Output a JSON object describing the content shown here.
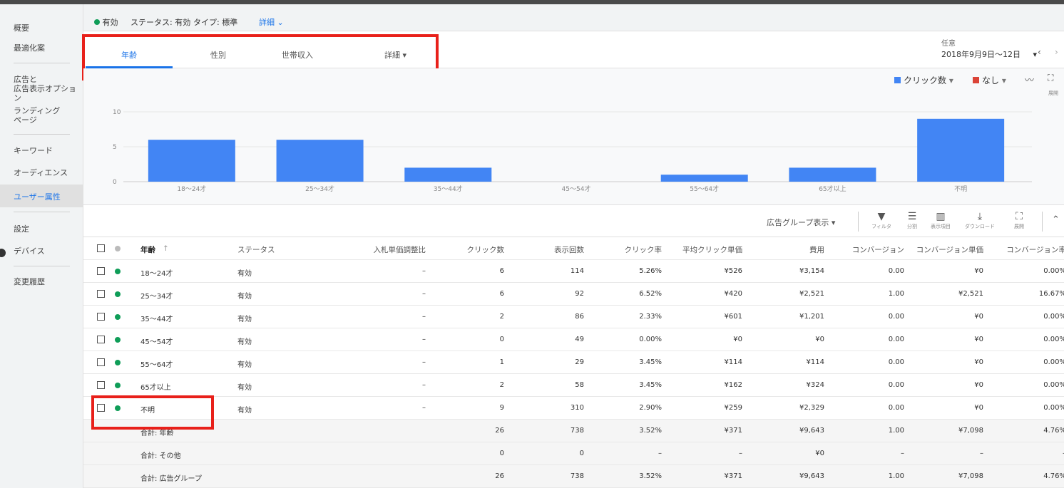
{
  "sidebar": {
    "items": [
      {
        "label": "概要"
      },
      {
        "label": "最適化案"
      },
      {
        "label": "広告と\n広告表示オプション"
      },
      {
        "label": "ランディング\nページ"
      },
      {
        "label": "キーワード"
      },
      {
        "label": "オーディエンス"
      },
      {
        "label": "ユーザー属性"
      },
      {
        "label": "設定"
      },
      {
        "label": "デバイス"
      },
      {
        "label": "変更履歴"
      }
    ]
  },
  "status": {
    "enabled": "有効",
    "status_text": "ステータス: 有効",
    "type_text": "タイプ: 標準",
    "detail": "詳細"
  },
  "tabs": [
    {
      "label": "年齢"
    },
    {
      "label": "性別"
    },
    {
      "label": "世帯収入"
    },
    {
      "label": "詳細"
    }
  ],
  "date": {
    "label": "任意",
    "range": "2018年9月9日～12日"
  },
  "chart_controls": {
    "metric1": "クリック数",
    "metric2": "なし",
    "expand": "展開",
    "metric1_color": "#4285f4",
    "metric2_color": "#db4437"
  },
  "chart_data": {
    "type": "bar",
    "categories": [
      "18～24才",
      "25～34才",
      "35～44才",
      "45～54才",
      "55～64才",
      "65才以上",
      "不明"
    ],
    "values": [
      6,
      6,
      2,
      0,
      1,
      2,
      9
    ],
    "yticks": [
      "0",
      "5",
      "10"
    ],
    "ylim": [
      0,
      10
    ],
    "color": "#4285f4"
  },
  "toolbar": {
    "view": "広告グループ表示",
    "filter": "フィルタ",
    "segment": "分割",
    "columns": "表示項目",
    "download": "ダウンロード",
    "expand": "展開"
  },
  "table": {
    "headers": [
      "年齢",
      "ステータス",
      "入札単価調整比",
      "クリック数",
      "表示回数",
      "クリック率",
      "平均クリック単価",
      "費用",
      "コンバージョン",
      "コンバージョン単価",
      "コンバージョン率"
    ],
    "rows": [
      [
        "18～24才",
        "有効",
        "–",
        "6",
        "114",
        "5.26%",
        "¥526",
        "¥3,154",
        "0.00",
        "¥0",
        "0.00%"
      ],
      [
        "25～34才",
        "有効",
        "–",
        "6",
        "92",
        "6.52%",
        "¥420",
        "¥2,521",
        "1.00",
        "¥2,521",
        "16.67%"
      ],
      [
        "35～44才",
        "有効",
        "–",
        "2",
        "86",
        "2.33%",
        "¥601",
        "¥1,201",
        "0.00",
        "¥0",
        "0.00%"
      ],
      [
        "45～54才",
        "有効",
        "–",
        "0",
        "49",
        "0.00%",
        "¥0",
        "¥0",
        "0.00",
        "¥0",
        "0.00%"
      ],
      [
        "55～64才",
        "有効",
        "–",
        "1",
        "29",
        "3.45%",
        "¥114",
        "¥114",
        "0.00",
        "¥0",
        "0.00%"
      ],
      [
        "65才以上",
        "有効",
        "–",
        "2",
        "58",
        "3.45%",
        "¥162",
        "¥324",
        "0.00",
        "¥0",
        "0.00%"
      ],
      [
        "不明",
        "有効",
        "–",
        "9",
        "310",
        "2.90%",
        "¥259",
        "¥2,329",
        "0.00",
        "¥0",
        "0.00%"
      ]
    ],
    "totals": [
      [
        "合計: 年齢",
        "",
        "",
        "26",
        "738",
        "3.52%",
        "¥371",
        "¥9,643",
        "1.00",
        "¥7,098",
        "4.76%"
      ],
      [
        "合計: その他",
        "",
        "",
        "0",
        "0",
        "–",
        "–",
        "¥0",
        "–",
        "–",
        "–"
      ],
      [
        "合計: 広告グループ",
        "",
        "",
        "26",
        "738",
        "3.52%",
        "¥371",
        "¥9,643",
        "1.00",
        "¥7,098",
        "4.76%"
      ]
    ]
  }
}
